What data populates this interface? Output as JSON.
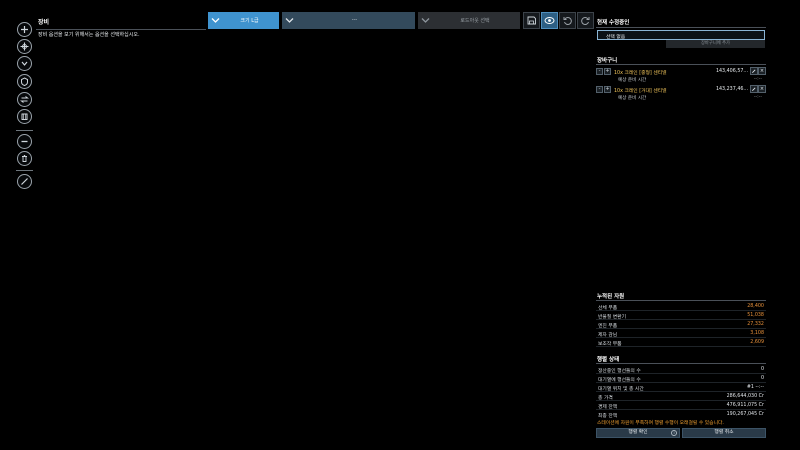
{
  "equipment": {
    "title": "장비",
    "hint": "장비 옵션을 보기 위해서는 옵션을 선택하십시오."
  },
  "toolbar": {
    "size_dropdown": "크기 L급",
    "blank_dropdown": "---",
    "loadout_dropdown": "로드아웃 선택"
  },
  "right_panel": {
    "current_ship_title": "현재 수정중인",
    "select_value": "선택 없음",
    "add_to_cart": "장바구니에 추가",
    "cart_title": "장바구니",
    "cart_items": [
      {
        "minus": "-",
        "plus": "+",
        "name": "10x 크레인 [중형] 센티넬",
        "price": "143,406,57...",
        "ready_label": "예상 준비 시간",
        "ready_value": "--:--"
      },
      {
        "minus": "-",
        "plus": "+",
        "name": "10x 크레인 [거대] 센티넬",
        "price": "143,237,46...",
        "ready_label": "예상 준비 시간",
        "ready_value": "--:--"
      }
    ],
    "resources_title": "누적된 자원",
    "resources": [
      {
        "label": "선체 부품",
        "value": "28,400"
      },
      {
        "label": "반물질 변환기",
        "value": "51,038"
      },
      {
        "label": "엔진 부품",
        "value": "27,332"
      },
      {
        "label": "제자 감님",
        "value": "3,108"
      },
      {
        "label": "보조작 부품",
        "value": "2,609"
      }
    ],
    "status_title": "행렬 상태",
    "status": [
      {
        "label": "정산중인 행선들의 수",
        "value": "0"
      },
      {
        "label": "대기열에 행선들의 수",
        "value": "0"
      },
      {
        "label": "대기열 위치 및 총 시간",
        "value": "#1 --:--"
      },
      {
        "label": "총 가격",
        "value": "286,644,030 Cr"
      },
      {
        "label": "경제 잔액",
        "value": "476,911,075 Cr"
      },
      {
        "label": "최종 잔액",
        "value": "190,267,045 Cr"
      }
    ],
    "warning": "스테이션에 자원이 부족하여 행렬 수행이 오래걸릴 수 있습니다.",
    "confirm_button": "행렬 확인",
    "info_icon_label": "i",
    "cancel_button": "행렬 취소"
  },
  "colors": {
    "accent_blue": "#3f93cf",
    "resource_orange": "#e8913a",
    "cart_item_gold": "#f0c45a",
    "warning_orange": "#f0a030"
  },
  "icons": [
    "plus-icon",
    "move-icon",
    "arrow-down-icon",
    "shield-icon",
    "swap-icon",
    "crate-icon",
    "minus-icon",
    "trash-icon",
    "cancel-icon",
    "save-icon",
    "eye-icon",
    "undo-icon",
    "redo-icon",
    "chevron-down-icon",
    "edit-icon",
    "close-icon"
  ]
}
